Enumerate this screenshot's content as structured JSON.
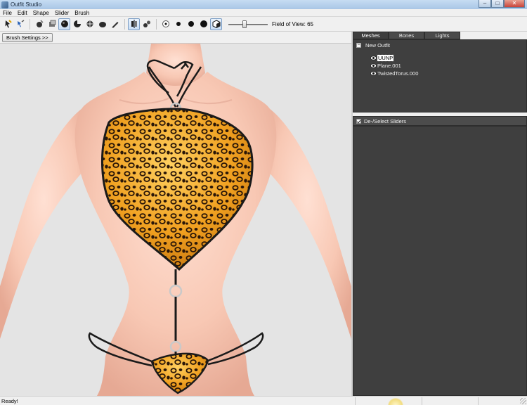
{
  "window": {
    "title": "Outfit Studio"
  },
  "window_controls": {
    "minimize": "–",
    "maximize": "□",
    "close": "✕"
  },
  "menu": [
    "File",
    "Edit",
    "Shape",
    "Slider",
    "Brush"
  ],
  "toolbar": {
    "fov_label": "Field of View: 65",
    "fov_value": 65
  },
  "brush_settings_label": "Brush Settings >>",
  "tabs": [
    {
      "label": "Meshes",
      "active": true
    },
    {
      "label": "Bones",
      "active": false
    },
    {
      "label": "Lights",
      "active": false
    }
  ],
  "tree": {
    "root": "New Outfit",
    "expander": "−",
    "items": [
      {
        "label": "UUNP",
        "selected": true
      },
      {
        "label": "Plane.001",
        "selected": false
      },
      {
        "label": "TwistedTorus.000",
        "selected": false
      }
    ]
  },
  "sliders_header": "De-/Select Sliders",
  "status": {
    "text": "Ready!"
  },
  "colors": {
    "skin": "#f7c7b2",
    "fabric": "#f0a020",
    "spots": "#2a1608",
    "strap": "#1a1a1a",
    "panel_dark": "#3f3f3f"
  }
}
